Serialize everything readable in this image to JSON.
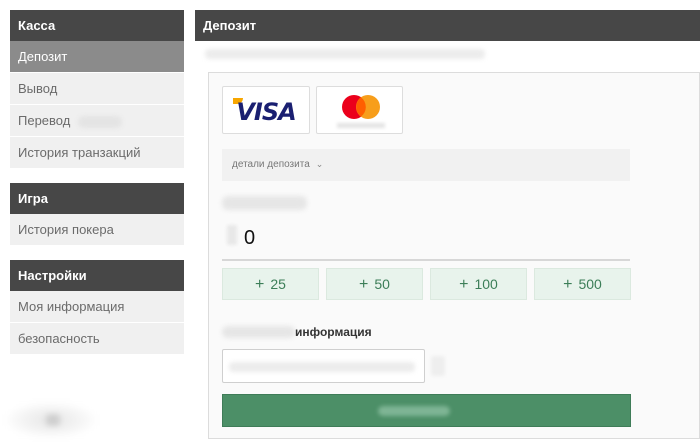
{
  "sidebar": {
    "groups": [
      {
        "title": "Касса",
        "items": [
          {
            "label": "Депозит",
            "active": true
          },
          {
            "label": "Вывод"
          },
          {
            "label": "Перевод"
          },
          {
            "label": "История транзакций"
          }
        ]
      },
      {
        "title": "Игра",
        "items": [
          {
            "label": "История покера"
          }
        ]
      },
      {
        "title": "Настройки",
        "items": [
          {
            "label": "Моя информация"
          },
          {
            "label": "безопасность"
          }
        ]
      }
    ]
  },
  "main": {
    "title": "Депозит",
    "payment_methods": [
      {
        "name": "VISA",
        "icon": "visa-logo"
      },
      {
        "name": "Mastercard",
        "icon": "mastercard-logo",
        "colors": [
          "#eb001b",
          "#f79e1b"
        ]
      }
    ],
    "details_label": "детали депозита",
    "amount_value": "0",
    "quick_amounts": [
      "25",
      "50",
      "100",
      "500"
    ],
    "info_label": "информация"
  },
  "colors": {
    "header_bg": "#474747",
    "active_item_bg": "#8b8b8b",
    "quick_btn_bg": "#e8f3ec",
    "quick_btn_text": "#3c7e58",
    "submit_bg": "#4c8f67"
  }
}
